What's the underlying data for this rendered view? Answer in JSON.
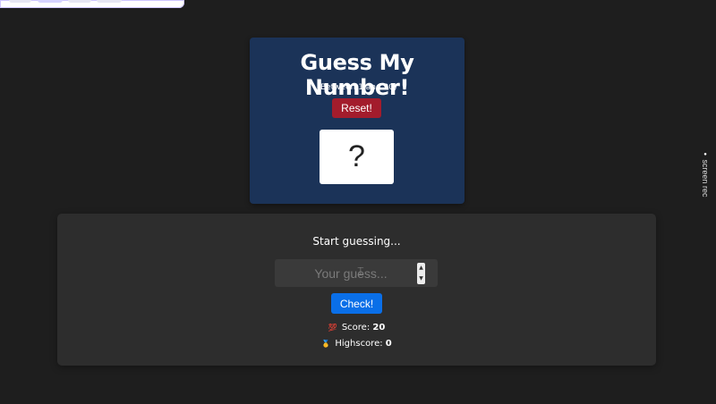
{
  "header": {
    "title": "Guess My Number!",
    "range_hint": "(Between 1 and 20)",
    "reset_label": "Reset!",
    "secret_display": "?"
  },
  "game": {
    "message": "Start guessing...",
    "guess_input": {
      "value": "",
      "placeholder": "Your guess..."
    },
    "stepper": {
      "up": "▲",
      "down": "▼"
    },
    "check_label": "Check!",
    "score_label": "Score:",
    "score_value": "20",
    "score_icon": "💯",
    "highscore_label": "Highscore:",
    "highscore_value": "0",
    "highscore_icon": "🥇"
  },
  "overlay": {
    "screen_rec_label": "screen rec",
    "screen_rec_small": "REC"
  },
  "colors": {
    "background": "#1e1e1e",
    "header_card": "#1b3358",
    "reset_button": "#a31c2c",
    "check_button": "#0a6fe8",
    "panel": "#2d2d2d"
  }
}
